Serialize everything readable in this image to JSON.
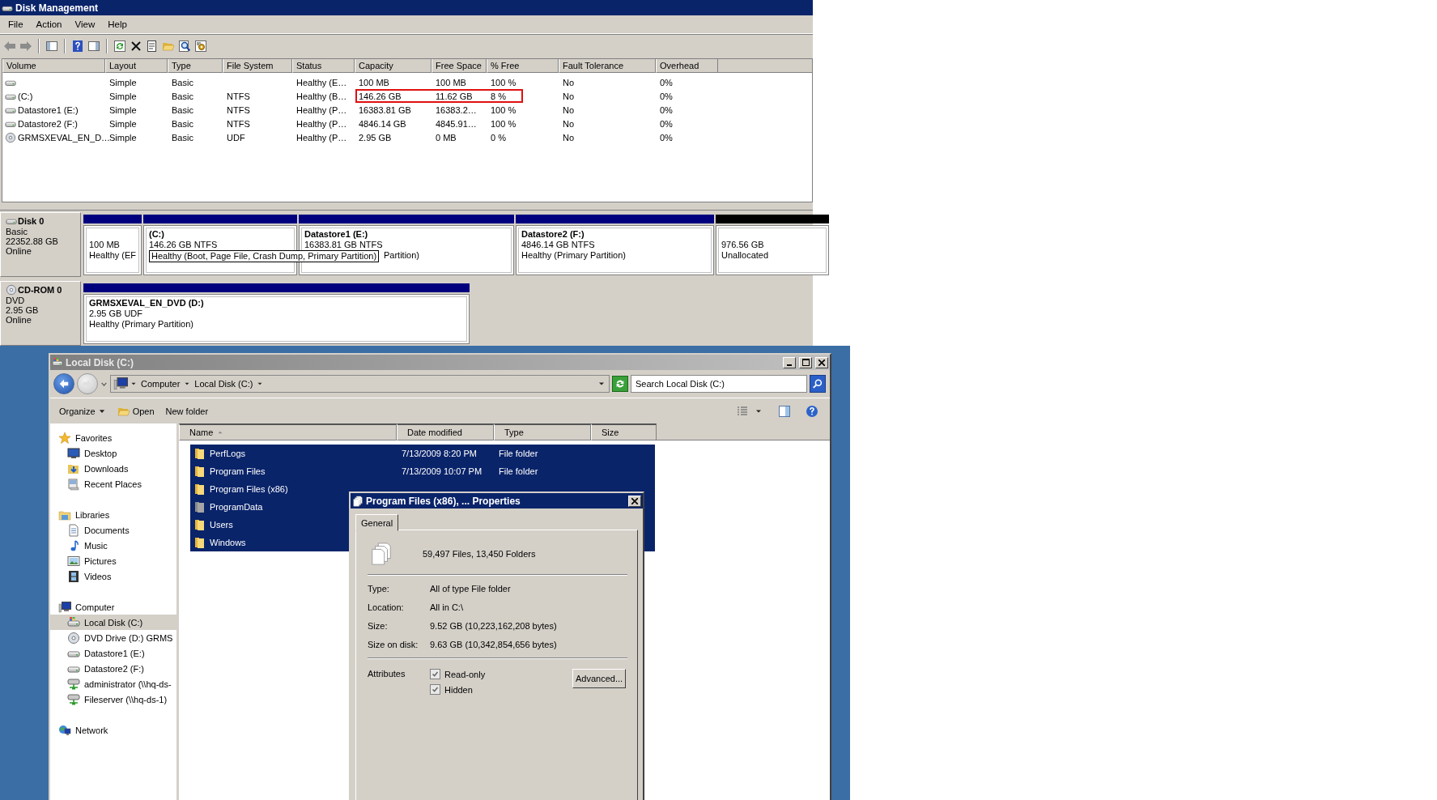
{
  "disk_management": {
    "title": "Disk Management",
    "menu": [
      {
        "label": "File"
      },
      {
        "label": "Action"
      },
      {
        "label": "View"
      },
      {
        "label": "Help"
      }
    ],
    "toolbar": [
      {
        "icons": [
          {
            "kind": "back"
          },
          {
            "kind": "forward"
          }
        ]
      },
      {
        "icons": [
          {
            "kind": "tree"
          }
        ]
      },
      {
        "icons": [
          {
            "kind": "help"
          },
          {
            "kind": "pane"
          }
        ]
      },
      {
        "icons": [
          {
            "kind": "refresh"
          },
          {
            "kind": "delete"
          },
          {
            "kind": "properties"
          },
          {
            "kind": "open"
          },
          {
            "kind": "find"
          },
          {
            "kind": "settings"
          }
        ]
      }
    ],
    "volumes": {
      "columns": [
        "Volume",
        "Layout",
        "Type",
        "File System",
        "Status",
        "Capacity",
        "Free Space",
        "% Free",
        "Fault Tolerance",
        "Overhead"
      ],
      "rows": [
        {
          "kind": "drive",
          "layout": "Simple",
          "type": "Basic",
          "status": "Healthy (E…",
          "capacity": "100 MB",
          "free_space": "100 MB",
          "percent_free": "100 %",
          "fault_tolerance": "No",
          "overhead": "0%",
          "outlined": false
        },
        {
          "kind": "drive",
          "volume": "(C:)",
          "layout": "Simple",
          "type": "Basic",
          "file_system": "NTFS",
          "status": "Healthy (B…",
          "capacity": "146.26 GB",
          "free_space": "11.62 GB",
          "percent_free": "8 %",
          "fault_tolerance": "No",
          "overhead": "0%",
          "outlined": true
        },
        {
          "kind": "drive",
          "volume": "Datastore1 (E:)",
          "layout": "Simple",
          "type": "Basic",
          "file_system": "NTFS",
          "status": "Healthy (P…",
          "capacity": "16383.81 GB",
          "free_space": "16383.2…",
          "percent_free": "100 %",
          "fault_tolerance": "No",
          "overhead": "0%",
          "outlined": false
        },
        {
          "kind": "drive",
          "volume": "Datastore2 (F:)",
          "layout": "Simple",
          "type": "Basic",
          "file_system": "NTFS",
          "status": "Healthy (P…",
          "capacity": "4846.14 GB",
          "free_space": "4845.91…",
          "percent_free": "100 %",
          "fault_tolerance": "No",
          "overhead": "0%",
          "outlined": false
        },
        {
          "kind": "dvd",
          "volume": "GRMSXEVAL_EN_D…",
          "layout": "Simple",
          "type": "Basic",
          "file_system": "UDF",
          "status": "Healthy (P…",
          "capacity": "2.95 GB",
          "free_space": "0 MB",
          "percent_free": "0 %",
          "fault_tolerance": "No",
          "overhead": "0%",
          "outlined": false
        }
      ]
    },
    "disks": [
      {
        "name": "Disk 0",
        "kind": "drive",
        "lines": [
          "Basic",
          "22352.88 GB",
          "Online"
        ],
        "partitions": [
          {
            "kind": "primary",
            "size": "100 MB",
            "status": "Healthy (EF",
            "covered": false
          },
          {
            "kind": "primary",
            "title": "(C:)",
            "size": "146.26 GB NTFS"
          },
          {
            "kind": "primary",
            "title": "Datastore1  (E:)",
            "size": "16383.81 GB NTFS",
            "status": "Partition)",
            "covered": true
          },
          {
            "kind": "primary",
            "title": "Datastore2  (F:)",
            "size": "4846.14 GB NTFS",
            "status": "Healthy (Primary Partition)",
            "covered": false
          },
          {
            "kind": "unallocated",
            "size": "976.56 GB",
            "status": "Unallocated",
            "covered": false
          }
        ]
      },
      {
        "name": "CD-ROM 0",
        "kind": "dvd",
        "lines": [
          "DVD",
          "2.95 GB",
          "Online"
        ],
        "partitions": [
          {
            "kind": "primary",
            "title": "GRMSXEVAL_EN_DVD  (D:)",
            "size": "2.95 GB UDF",
            "status": "Healthy (Primary Partition)",
            "covered": false
          }
        ]
      }
    ],
    "tooltip": "Healthy (Boot, Page File, Crash Dump, Primary Partition)"
  },
  "explorer": {
    "title": "Local Disk (C:)",
    "breadcrumb": [
      "Computer",
      "Local Disk (C:)"
    ],
    "search": {
      "placeholder": "Search Local Disk (C:)"
    },
    "commands": [
      {
        "kind": "menu",
        "label": "Organize"
      },
      {
        "kind": "open",
        "label": "Open"
      },
      {
        "kind": "plain",
        "label": "New folder"
      }
    ],
    "nav": [
      {
        "label": "Favorites",
        "kind": "star",
        "selected": false,
        "children": [
          {
            "label": "Desktop",
            "kind": "desktop",
            "selected": false
          },
          {
            "label": "Downloads",
            "kind": "downloads",
            "selected": false
          },
          {
            "label": "Recent Places",
            "kind": "recent",
            "selected": false
          }
        ]
      },
      {
        "label": "Libraries",
        "kind": "library",
        "selected": false,
        "children": [
          {
            "label": "Documents",
            "kind": "document",
            "selected": false
          },
          {
            "label": "Music",
            "kind": "music",
            "selected": false
          },
          {
            "label": "Pictures",
            "kind": "pictures",
            "selected": false
          },
          {
            "label": "Videos",
            "kind": "videos",
            "selected": false
          }
        ]
      },
      {
        "label": "Computer",
        "kind": "computer",
        "selected": false,
        "children": [
          {
            "label": "Local Disk (C:)",
            "kind": "localdisk",
            "selected": true
          },
          {
            "label": "DVD Drive (D:) GRMS",
            "kind": "dvd",
            "selected": false
          },
          {
            "label": "Datastore1 (E:)",
            "kind": "drive",
            "selected": false
          },
          {
            "label": "Datastore2 (F:)",
            "kind": "drive",
            "selected": false
          },
          {
            "label": "administrator (\\\\hq-ds-",
            "kind": "netdrive",
            "selected": false
          },
          {
            "label": "Fileserver (\\\\hq-ds-1)",
            "kind": "netdrive",
            "selected": false
          }
        ]
      },
      {
        "label": "Network",
        "kind": "network",
        "selected": false
      }
    ],
    "columns": [
      {
        "label": "Name",
        "sorted": true
      },
      {
        "label": "Date modified",
        "sorted": false
      },
      {
        "label": "Type",
        "sorted": false
      },
      {
        "label": "Size",
        "sorted": false
      }
    ],
    "files": [
      {
        "name": "PerfLogs",
        "date": "7/13/2009 8:20 PM",
        "type": "File folder",
        "hidden": false,
        "selected": true
      },
      {
        "name": "Program Files",
        "date": "7/13/2009 10:07 PM",
        "type": "File folder",
        "hidden": false,
        "selected": true
      },
      {
        "name": "Program Files (x86)",
        "hidden": false,
        "selected": true
      },
      {
        "name": "ProgramData",
        "hidden": true,
        "selected": true
      },
      {
        "name": "Users",
        "hidden": false,
        "selected": true
      },
      {
        "name": "Windows",
        "hidden": false,
        "selected": true
      }
    ]
  },
  "properties": {
    "title": "Program Files (x86), ... Properties",
    "tabs": [
      {
        "label": "General",
        "selected": true
      }
    ],
    "summary": "59,497 Files, 13,450 Folders",
    "fields": [
      {
        "label": "Type:",
        "value": "All of type File folder"
      },
      {
        "label": "Location:",
        "value": "All in C:\\"
      },
      {
        "label": "Size:",
        "value": "9.52 GB (10,223,162,208 bytes)"
      },
      {
        "label": "Size on disk:",
        "value": "9.63 GB (10,342,854,656 bytes)"
      }
    ],
    "attributes_label": "Attributes",
    "attributes": [
      {
        "label": "Read-only",
        "checked": true
      },
      {
        "label": "Hidden",
        "checked": true
      }
    ],
    "advanced_button": "Advanced..."
  }
}
